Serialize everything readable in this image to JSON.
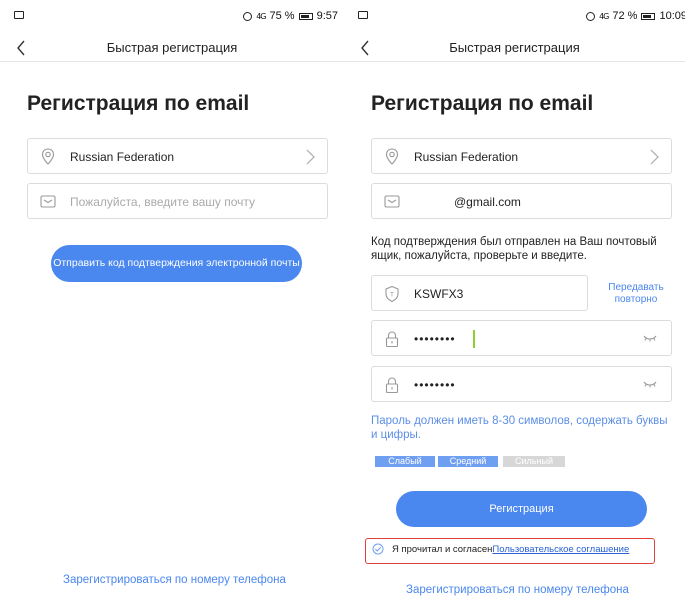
{
  "left": {
    "status": {
      "alarm": "alarm-icon",
      "network": "4G",
      "battery_pct": "75 %",
      "time": "9:57"
    },
    "nav": {
      "title": "Быстрая регистрация"
    },
    "page_title": "Регистрация по email",
    "country": "Russian Federation",
    "email_placeholder": "Пожалуйста, введите вашу почту",
    "send_code_button": "Отправить код подтверждения электронной почты",
    "phone_link": "Зарегистрироваться по номеру телефона"
  },
  "right": {
    "status": {
      "alarm": "alarm-icon",
      "network": "4G",
      "battery_pct": "72 %",
      "time": "10:09"
    },
    "nav": {
      "title": "Быстрая регистрация"
    },
    "page_title": "Регистрация по email",
    "country": "Russian Federation",
    "email_value": "@gmail.com",
    "code_sent_info": "Код подтверждения был отправлен на Ваш почтовый ящик, пожалуйста, проверьте и введите.",
    "code_value": "KSWFX3",
    "resend_line1": "Передавать",
    "resend_line2": "повторно",
    "password_mask": "••••••••",
    "password_confirm_mask": "••••••••",
    "password_hint": "Пароль должен иметь 8-30 символов, содержать буквы и цифры.",
    "strength": {
      "weak": "Слабый",
      "medium": "Средний",
      "strong": "Сильный",
      "level": "medium"
    },
    "register_button": "Регистрация",
    "agreement_prefix": "Я прочитал и согласен",
    "agreement_link": "Пользовательское соглашение",
    "phone_link": "Зарегистрироваться по номеру телефона"
  },
  "colors": {
    "accent": "#4a87ef",
    "link": "#4a87ef",
    "highlight_border": "#e0403c",
    "strength_active": "#6f9ff0",
    "strength_inactive": "#d7d7d7",
    "cursor": "#8ccf2e"
  }
}
